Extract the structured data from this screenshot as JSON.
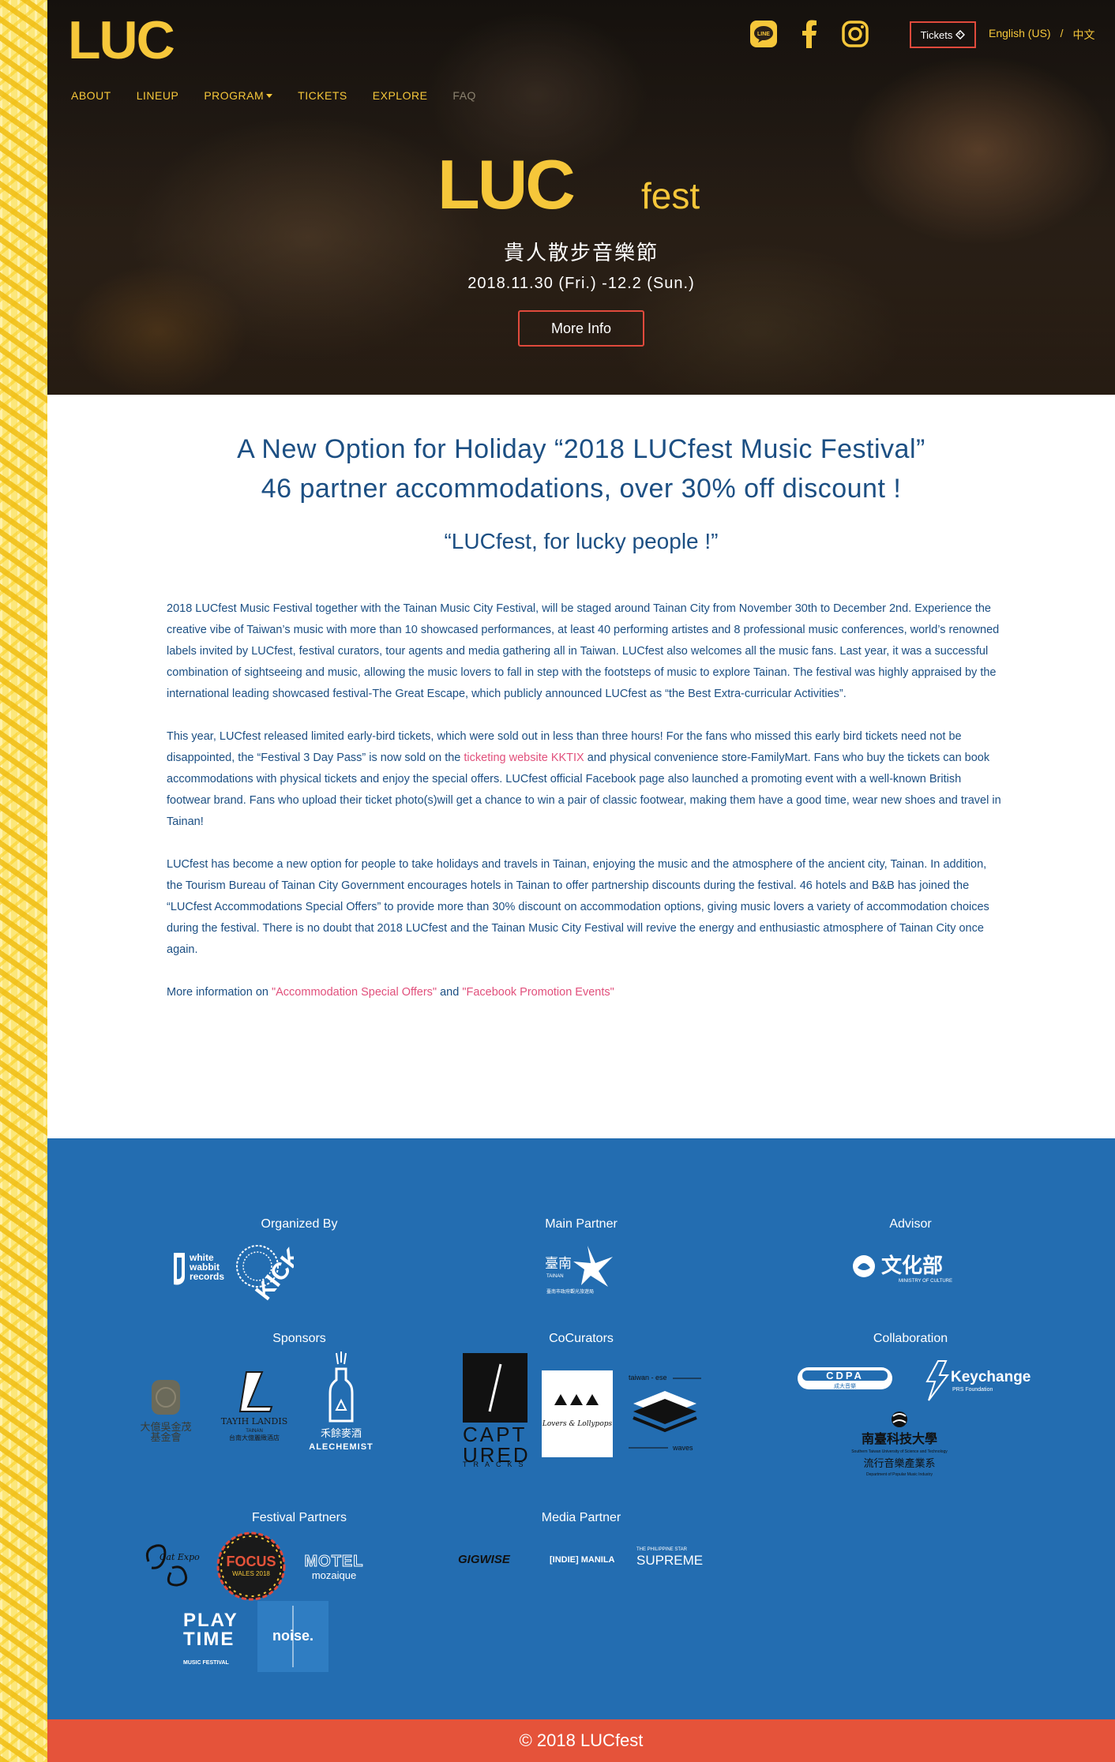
{
  "nav": {
    "items": [
      "ABOUT",
      "LINEUP",
      "PROGRAM",
      "TICKETS",
      "EXPLORE",
      "FAQ"
    ]
  },
  "header": {
    "logo_text": "LUC",
    "tickets_label": "Tickets",
    "lang_english": "English (US)",
    "lang_separator": "/",
    "lang_chinese": "中文"
  },
  "hero": {
    "logo_text": "LUC",
    "logo_suffix": "fest",
    "subtitle": "貴人散步音樂節",
    "date": "2018.11.30 (Fri.) -12.2 (Sun.)",
    "more_button": "More Info"
  },
  "article": {
    "headline_line1": "A New Option for Holiday “2018 LUCfest Music Festival”",
    "headline_line2": "46 partner accommodations, over 30% off discount !",
    "tagline": "“LUCfest, for lucky people !”",
    "p1": "2018 LUCfest Music Festival together with the Tainan Music City Festival, will be staged around Tainan City from November 30th to December 2nd. Experience the creative vibe of Taiwan’s music with more than 10 showcased performances, at least 40 performing artistes and 8 professional music conferences, world’s renowned labels invited by LUCfest, festival curators, tour agents and media gathering all in Taiwan. LUCfest also welcomes all the music fans. Last year, it was a successful combination of sightseeing and music, allowing the music lovers to fall in step with the footsteps of music to explore Tainan. The festival was highly appraised by the international leading showcased festival-The Great Escape, which publicly announced LUCfest as “the Best Extra-curricular Activities”.",
    "p2_before": "This year, LUCfest released limited early-bird tickets, which were sold out in less than three hours! For the fans who missed this early bird tickets need not be disappointed, the “Festival 3 Day Pass” is now sold on the ",
    "p2_link": "ticketing website KKTIX",
    "p2_after": " and physical convenience store-FamilyMart. Fans who buy the tickets can book accommodations with physical tickets and enjoy the special offers. LUCfest official Facebook page also launched a promoting event with a well-known British footwear brand. Fans who upload their ticket photo(s)will get a chance to win a pair of classic footwear, making them have a good time, wear new shoes and travel in Tainan!",
    "p3": "LUCfest has become a new option for people to take holidays and travels in Tainan, enjoying the music and the atmosphere of the ancient city, Tainan. In addition, the Tourism Bureau of Tainan City Government encourages hotels in Tainan to offer partnership discounts during the festival. 46 hotels and B&B has joined the “LUCfest Accommodations Special Offers” to provide more than 30% discount on accommodation options, giving music lovers a variety of accommodation choices during the festival. There is no doubt that 2018 LUCfest and the Tainan Music City Festival will revive the energy and enthusiastic atmosphere of Tainan City once again.",
    "more_prefix": "More information on ",
    "more_link1": "\"Accommodation Special Offers\"",
    "more_and": " and ",
    "more_link2": "\"Facebook Promotion Events\""
  },
  "partners": {
    "organized_by": "Organized By",
    "main_partner": "Main Partner",
    "advisor": "Advisor",
    "sponsors": "Sponsors",
    "cocurators": "CoCurators",
    "collaboration": "Collaboration",
    "festival_partners": "Festival Partners",
    "media_partner": "Media Partner",
    "logos": {
      "white_rabbit": "white\nwabbit\nrecords",
      "kick": "KICK",
      "tainan": "臺南",
      "tainan_small": "TAINAN",
      "tainan_caption": "臺南市政府觀光旅遊局",
      "moc": "文化部",
      "moc_caption": "MINISTRY OF CULTURE",
      "ta_chong": "大億吳金茂\n基金會",
      "tayih_landis": "TAYIH LANDIS",
      "tayih_caption": "台南大億麗緻酒店",
      "tayih_city": "TAINAN",
      "alechemist": "ALECHEMIST",
      "alechemist_cn": "禾餘麥酒",
      "captured": "CAPT\nURED",
      "captured_small": "TRACKS",
      "lovers": "Lovers & Lollypops",
      "taiwanese": "taiwan - ese",
      "waves": "waves",
      "cdpa": "CDPA",
      "cdpa_caption": "成大音樂",
      "keychange": "Keychange",
      "keychange_caption": "PRS Foundation",
      "stust": "南臺科技大學",
      "stust_en": "Southern Taiwan University of Science and Technology",
      "stust_dept": "流行音樂產業系",
      "stust_dept_en": "Department of Popular Music Industry",
      "catexpo": "Cat Expo",
      "focus": "FOCUS",
      "focus_sub": "WALES 2018",
      "motel": "MOTEL",
      "motel_sub": "mozaique",
      "playtime": "PLAY\nTIME",
      "playtime_sub": "MUSIC FESTIVAL",
      "noise": "noise.",
      "gigwise": "GIGWISE",
      "indie_manila": "[INDIE] MANILA",
      "supreme_small": "THE PHILIPPINE STAR",
      "supreme": "SUPREME"
    }
  },
  "footer": {
    "copyright": "© 2018 LUCfest"
  },
  "colors": {
    "brand_yellow": "#f6c73a",
    "accent_red": "#e04a3c",
    "text_blue": "#1c4f83",
    "partner_blue": "#236db1",
    "link_pink": "#e1507c",
    "footer_red": "#e5533a"
  }
}
